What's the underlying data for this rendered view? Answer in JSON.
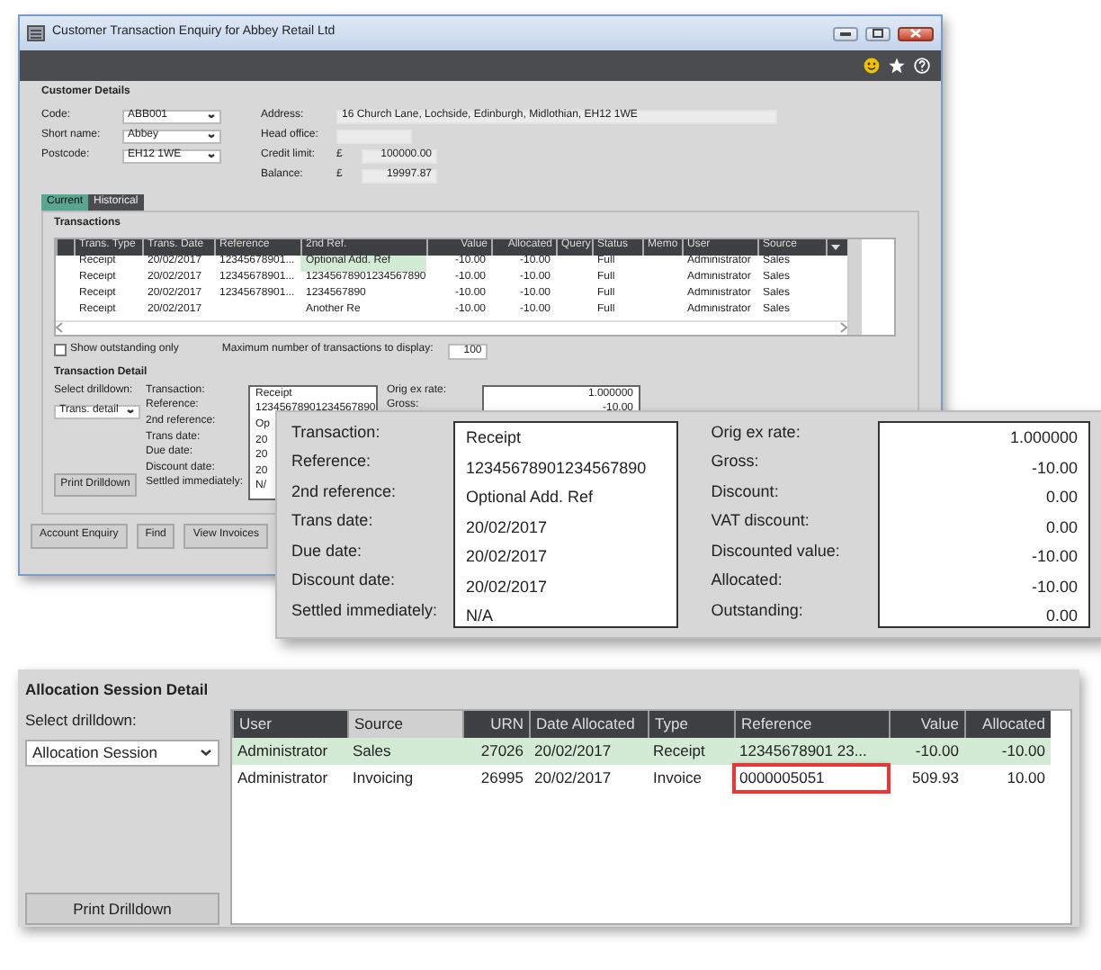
{
  "window": {
    "title": "Customer Transaction Enquiry for Abbey Retail Ltd"
  },
  "customer_details": {
    "heading": "Customer Details",
    "left_fields": [
      {
        "label": "Code:",
        "value": "ABB001",
        "kind": "dropdown"
      },
      {
        "label": "Short name:",
        "value": "Abbey",
        "kind": "dropdown"
      },
      {
        "label": "Postcode:",
        "value": "EH12 1WE",
        "kind": "dropdown"
      }
    ],
    "right_fields": [
      {
        "label": "Address:",
        "value": "16 Church Lane, Lochside, Edinburgh, Midlothian, EH12 1WE",
        "kind": "text"
      },
      {
        "label": "Head office:",
        "kind": "text"
      },
      {
        "label": "Credit limit:",
        "currency": "£",
        "value": "100000.00",
        "kind": "money"
      },
      {
        "label": "Balance:",
        "currency": "£",
        "value": "19997.87",
        "kind": "money"
      }
    ]
  },
  "tabs": [
    {
      "label": "Current",
      "selected": true
    },
    {
      "label": "Historical",
      "selected": false
    }
  ],
  "transactions": {
    "heading": "Transactions",
    "columns": [
      {
        "label": "Trans. Type",
        "kind": "text"
      },
      {
        "label": "Trans. Date",
        "kind": "text"
      },
      {
        "label": "Reference",
        "kind": "text"
      },
      {
        "label": "2nd Ref.",
        "kind": "text"
      },
      {
        "label": "Value",
        "kind": "number"
      },
      {
        "label": "Allocated",
        "kind": "number"
      },
      {
        "label": "Query",
        "kind": "text"
      },
      {
        "label": "Status",
        "kind": "text"
      },
      {
        "label": "Memo",
        "kind": "text"
      },
      {
        "label": "User",
        "kind": "text"
      },
      {
        "label": "Source",
        "kind": "text"
      }
    ],
    "rows": [
      {
        "cells": [
          "Receipt",
          "20/02/2017",
          "12345678901...",
          {
            "text": "Optional Add. Ref",
            "selected": true
          },
          "-10.00",
          "-10.00",
          null,
          "Full",
          null,
          "Administrator",
          "Sales"
        ]
      },
      {
        "cells": [
          "Receipt",
          "20/02/2017",
          "12345678901...",
          "12345678901234567890",
          "-10.00",
          "-10.00",
          null,
          "Full",
          null,
          "Administrator",
          "Sales"
        ]
      },
      {
        "cells": [
          "Receipt",
          "20/02/2017",
          "12345678901...",
          "1234567890",
          "-10.00",
          "-10.00",
          null,
          "Full",
          null,
          "Administrator",
          "Sales"
        ]
      },
      {
        "cells": [
          "Receipt",
          "20/02/2017",
          null,
          "Another Re",
          "-10.00",
          "-10.00",
          null,
          "Full",
          null,
          "Administrator",
          "Sales"
        ]
      }
    ]
  },
  "show_outstanding": {
    "label": "Show outstanding only",
    "checked": false
  },
  "max_transactions": {
    "label": "Maximum number of transactions to display:",
    "value": "100"
  },
  "transaction_detail": {
    "heading": "Transaction Detail",
    "drilldown_label": "Select drilldown:",
    "drilldown_value": "Trans. detail",
    "print_button": "Print Drilldown",
    "left": [
      {
        "label": "Transaction:",
        "value": "Receipt"
      },
      {
        "label": "Reference:",
        "value": "12345678901234567890"
      },
      {
        "label": "2nd reference:",
        "value": "Op"
      },
      {
        "label": "Trans date:",
        "value": "20"
      },
      {
        "label": "Due date:",
        "value": "20"
      },
      {
        "label": "Discount date:",
        "value": "20"
      },
      {
        "label": "Settled immediately:",
        "value": "N/"
      }
    ],
    "right": [
      {
        "label": "Orig ex rate:",
        "value": "1.000000"
      },
      {
        "label": "Gross:",
        "value": "-10.00"
      }
    ]
  },
  "footer_buttons": [
    "Account Enquiry",
    "Find",
    "View Invoices"
  ],
  "detail_zoom": {
    "left": [
      {
        "label": "Transaction:",
        "value": "Receipt"
      },
      {
        "label": "Reference:",
        "value": "12345678901234567890"
      },
      {
        "label": "2nd reference:",
        "value": "Optional Add. Ref"
      },
      {
        "label": "Trans date:",
        "value": "20/02/2017"
      },
      {
        "label": "Due date:",
        "value": "20/02/2017"
      },
      {
        "label": "Discount date:",
        "value": "20/02/2017"
      },
      {
        "label": "Settled immediately:",
        "value": "N/A"
      }
    ],
    "right": [
      {
        "label": "Orig ex rate:",
        "value": "1.000000"
      },
      {
        "label": "Gross:",
        "value": "-10.00"
      },
      {
        "label": "Discount:",
        "value": "0.00"
      },
      {
        "label": "VAT discount:",
        "value": "0.00"
      },
      {
        "label": "Discounted value:",
        "value": "-10.00"
      },
      {
        "label": "Allocated:",
        "value": "-10.00"
      },
      {
        "label": "Outstanding:",
        "value": "0.00"
      }
    ]
  },
  "allocation_session": {
    "heading": "Allocation Session Detail",
    "drilldown_label": "Select drilldown:",
    "drilldown_value": "Allocation Session",
    "print_button": "Print Drilldown",
    "columns": [
      {
        "label": "User",
        "kind": "text",
        "selected": false
      },
      {
        "label": "Source",
        "kind": "text",
        "selected": true
      },
      {
        "label": "URN",
        "kind": "number",
        "selected": false
      },
      {
        "label": "Date Allocated",
        "kind": "text",
        "selected": false
      },
      {
        "label": "Type",
        "kind": "text",
        "selected": false
      },
      {
        "label": "Reference",
        "kind": "text",
        "selected": false
      },
      {
        "label": "Value",
        "kind": "number",
        "selected": false
      },
      {
        "label": "Allocated",
        "kind": "number",
        "selected": false
      }
    ],
    "rows": [
      {
        "selected": true,
        "cells": [
          "Administrator",
          "Sales",
          "27026",
          "20/02/2017",
          "Receipt",
          "12345678901 23...",
          "-10.00",
          "-10.00"
        ]
      },
      {
        "selected": false,
        "cells": [
          "Administrator",
          "Invoicing",
          "26995",
          "20/02/2017",
          "Invoice",
          {
            "text": "0000005051",
            "outlined": true
          },
          "509.93",
          "10.00"
        ]
      }
    ]
  }
}
